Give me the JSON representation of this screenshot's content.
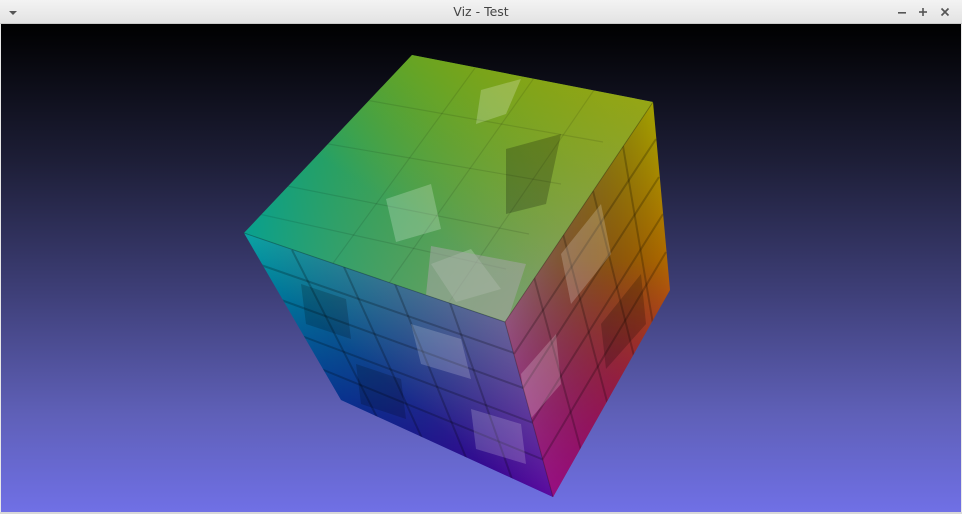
{
  "window": {
    "title": "Viz - Test"
  },
  "icons": {
    "menu": "chevron-down-icon",
    "minimize": "minimize-icon",
    "maximize": "maximize-icon",
    "close": "close-icon"
  },
  "colors": {
    "background_top": "#000000",
    "background_bottom": "#7070e6",
    "cube_top_corner": "#00a000",
    "cube_yellow_corner": "#b0b000",
    "cube_cyan_corner": "#00b0b0",
    "cube_white_corner": "#999999",
    "cube_red_corner": "#b00000",
    "cube_blue_corner": "#0000a0",
    "cube_magenta_corner": "#a000a0"
  }
}
